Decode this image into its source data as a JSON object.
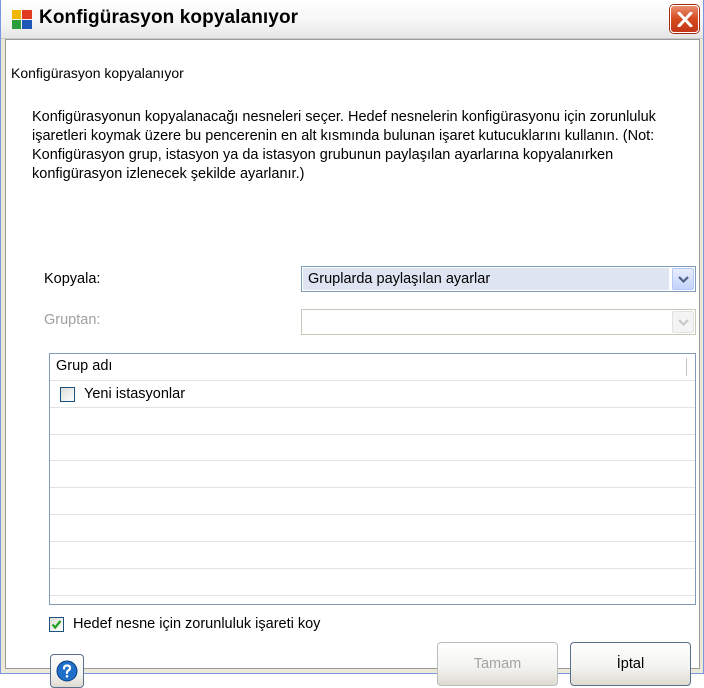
{
  "window": {
    "title": "Konfigürasyon kopyalanıyor",
    "icon": "avg-logo-icon",
    "close_icon": "close-icon"
  },
  "dialog": {
    "subheading": "Konfigürasyon kopyalanıyor",
    "description": "Konfigürasyonun kopyalanacağı nesneleri seçer. Hedef nesnelerin konfigürasyonu için zorunluluk işaretleri koymak üzere bu pencerenin en alt kısmında bulunan işaret kutucuklarını kullanın. (Not: Konfigürasyon grup, istasyon ya da istasyon grubunun paylaşılan ayarlarına kopyalanırken konfigürasyon izlenecek şekilde ayarlanır.)",
    "copy_label": "Kopyala:",
    "copy_value": "Gruplarda paylaşılan ayarlar",
    "from_label": "Gruptan:",
    "from_value": "",
    "list": {
      "column_header": "Grup adı",
      "items": [
        {
          "label": "Yeni istasyonlar",
          "checked": false
        }
      ]
    },
    "force_check": {
      "label": "Hedef nesne için zorunluluk işareti koy",
      "checked": true
    },
    "buttons": {
      "help_icon": "help-icon",
      "ok": "Tamam",
      "cancel": "İptal"
    }
  },
  "colors": {
    "title_bar": "#f4f4f4",
    "close_button": "#d54a1f",
    "selection": "#dfe4f2",
    "border": "#7f9db9",
    "disabled_text": "#a0a0a0"
  }
}
